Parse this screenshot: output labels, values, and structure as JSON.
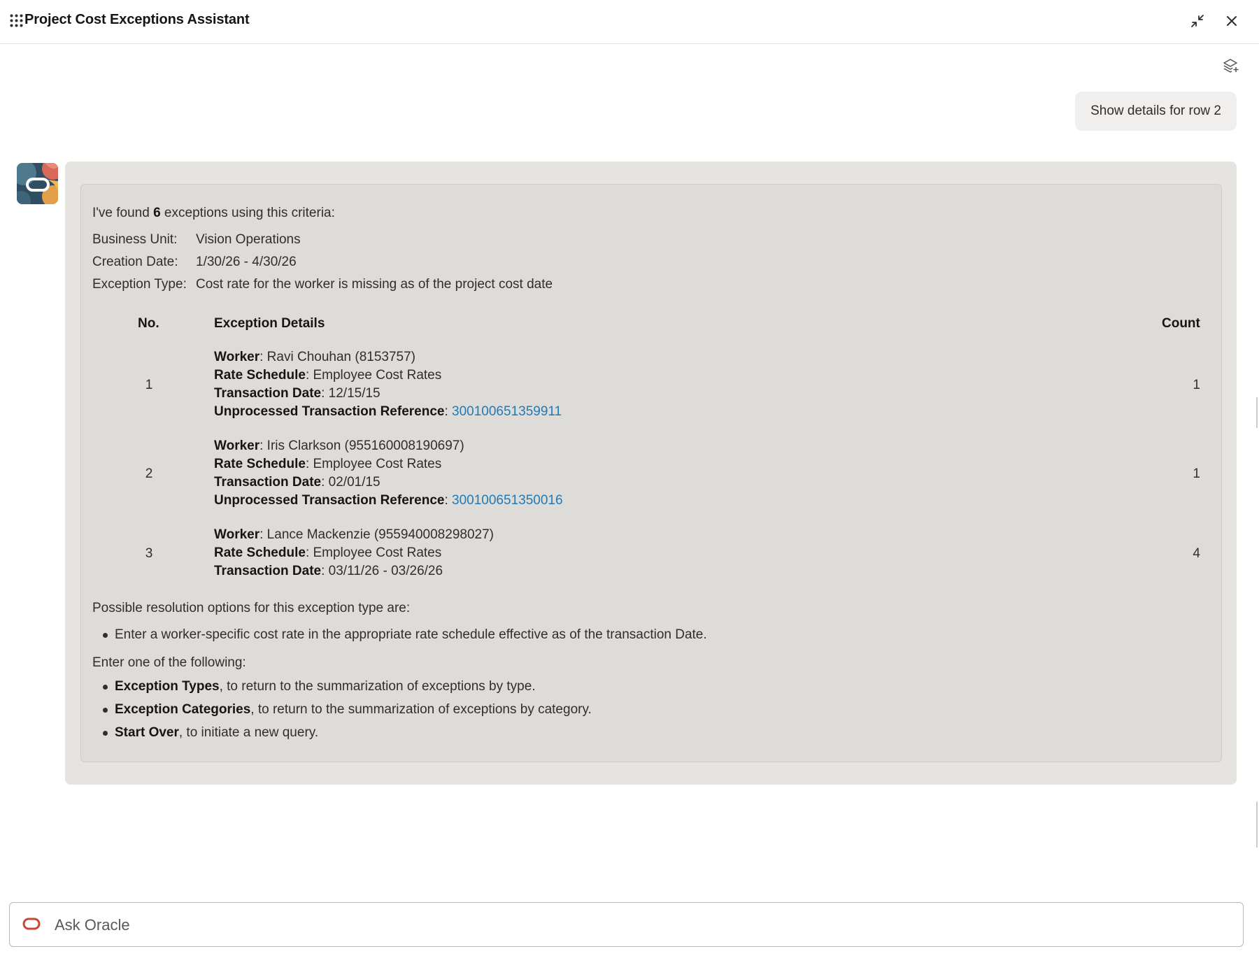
{
  "header": {
    "title": "Project Cost Exceptions Assistant",
    "apps_icon": "grid-dots-icon",
    "minimize_icon": "collapse-arrows-icon",
    "close_icon": "close-icon"
  },
  "toolbar": {
    "layers_icon": "layers-add-icon"
  },
  "user_message": {
    "text": "Show details for row 2"
  },
  "bot_message": {
    "intro_prefix": "I've found ",
    "intro_count": "6",
    "intro_suffix": " exceptions using this criteria:",
    "criteria": [
      {
        "label": "Business Unit:",
        "value": "Vision Operations"
      },
      {
        "label": "Creation Date:",
        "value": "1/30/26 - 4/30/26"
      },
      {
        "label": "Exception Type:",
        "value": "Cost rate for the worker is missing as of the project cost date"
      }
    ],
    "table": {
      "headers": {
        "no": "No.",
        "details": "Exception Details",
        "count": "Count"
      },
      "rows": [
        {
          "no": "1",
          "worker_label": "Worker",
          "worker": ": Ravi Chouhan (8153757)",
          "rate_label": "Rate Schedule",
          "rate": ": Employee Cost Rates",
          "date_label": "Transaction Date",
          "date": ": 12/15/15",
          "ref_label": "Unprocessed Transaction Reference",
          "ref_sep": ": ",
          "ref": "300100651359911",
          "count": "1"
        },
        {
          "no": "2",
          "worker_label": "Worker",
          "worker": ": Iris Clarkson (955160008190697)",
          "rate_label": "Rate Schedule",
          "rate": ": Employee Cost Rates",
          "date_label": "Transaction Date",
          "date": ": 02/01/15",
          "ref_label": "Unprocessed Transaction Reference",
          "ref_sep": ": ",
          "ref": "300100651350016",
          "count": "1"
        },
        {
          "no": "3",
          "worker_label": "Worker",
          "worker": ": Lance Mackenzie (955940008298027)",
          "rate_label": "Rate Schedule",
          "rate": ": Employee Cost Rates",
          "date_label": "Transaction Date",
          "date": ": 03/11/26 - 03/26/26",
          "count": "4"
        }
      ]
    },
    "resolution_heading": "Possible resolution options for this exception type are:",
    "resolution_options": [
      "Enter a worker-specific cost rate in the appropriate rate schedule effective as of the transaction Date."
    ],
    "enter_heading": "Enter one of the following:",
    "enter_options": [
      {
        "bold": "Exception Types",
        "rest": ", to return to the summarization of exceptions by type."
      },
      {
        "bold": "Exception Categories",
        "rest": ", to return to the summarization of exceptions by category."
      },
      {
        "bold": "Start Over",
        "rest": ", to initiate a new query."
      }
    ]
  },
  "input": {
    "placeholder": "Ask Oracle",
    "value": ""
  },
  "colors": {
    "link": "#227ab5",
    "oracle_red": "#c74634",
    "bubble_outer": "#e6e4e1",
    "bubble_inner": "#dedcd9"
  }
}
